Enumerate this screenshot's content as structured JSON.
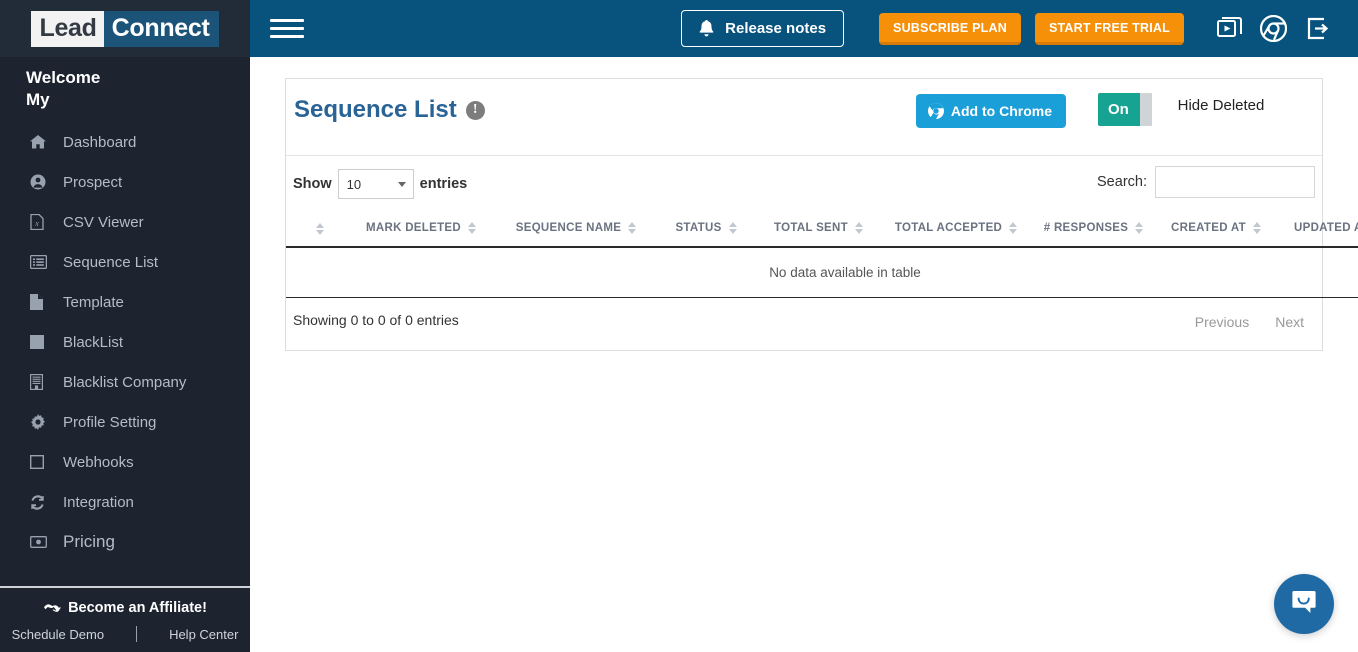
{
  "brand": {
    "logo_first": "Lead",
    "logo_second": "Connect",
    "accent_blue": "#1b5478",
    "header_blue": "#08537e",
    "sidebar_bg": "#1d2430",
    "orange": "#f79009",
    "chrome_blue": "#1a9fd9",
    "toggle_teal": "#17a391",
    "title_blue": "#2a6496",
    "intercom_blue": "#1f6aa5"
  },
  "sidebar": {
    "welcome_line1": "Welcome",
    "welcome_line2": "My",
    "items": [
      {
        "label": "Dashboard",
        "icon": "home-icon"
      },
      {
        "label": "Prospect",
        "icon": "user-circle-icon"
      },
      {
        "label": "CSV Viewer",
        "icon": "csv-file-icon"
      },
      {
        "label": "Sequence List",
        "icon": "list-table-icon"
      },
      {
        "label": "Template",
        "icon": "document-icon"
      },
      {
        "label": "BlackList",
        "icon": "square-icon"
      },
      {
        "label": "Blacklist Company",
        "icon": "building-icon"
      },
      {
        "label": "Profile Setting",
        "icon": "gear-icon"
      },
      {
        "label": "Webhooks",
        "icon": "empty-square-icon"
      },
      {
        "label": "Integration",
        "icon": "refresh-icon"
      },
      {
        "label": "Pricing",
        "icon": "money-icon"
      }
    ],
    "footer": {
      "affiliate": "Become an Affiliate!",
      "affiliate_icon": "handshake-icon",
      "schedule_demo": "Schedule Demo",
      "help_center": "Help Center"
    }
  },
  "topbar": {
    "menu_icon": "hamburger-icon",
    "release_notes": "Release notes",
    "release_notes_icon": "bell-icon",
    "subscribe_plan": "SUBSCRIBE PLAN",
    "start_free_trial": "START FREE TRIAL",
    "icons": [
      {
        "name": "video-tutorials-icon"
      },
      {
        "name": "chrome-extension-icon"
      },
      {
        "name": "logout-icon"
      }
    ]
  },
  "panel": {
    "title": "Sequence List",
    "info_icon": "exclamation-info-icon",
    "info_glyph": "!",
    "add_to_chrome": "Add to Chrome",
    "add_to_chrome_icon": "chrome-icon",
    "toggle": {
      "state_label": "On",
      "caption": "Hide Deleted"
    },
    "controls": {
      "show_label": "Show",
      "entries_label": "entries",
      "page_length": "10",
      "search_label": "Search:",
      "search_value": "",
      "search_placeholder": ""
    },
    "table": {
      "columns": [
        {
          "label": "",
          "sortable": true,
          "active": false
        },
        {
          "label": "MARK DELETED",
          "sortable": true,
          "active": false
        },
        {
          "label": "SEQUENCE NAME",
          "sortable": true,
          "active": false
        },
        {
          "label": "STATUS",
          "sortable": true,
          "active": false
        },
        {
          "label": "TOTAL SENT",
          "sortable": true,
          "active": false
        },
        {
          "label": "TOTAL ACCEPTED",
          "sortable": true,
          "active": false
        },
        {
          "label": "# RESPONSES",
          "sortable": true,
          "active": false
        },
        {
          "label": "CREATED AT",
          "sortable": true,
          "active": false
        },
        {
          "label": "UPDATED AT",
          "sortable": true,
          "active": true
        }
      ],
      "rows": [],
      "empty_message": "No data available in table"
    },
    "footer": {
      "info": "Showing 0 to 0 of 0 entries",
      "previous": "Previous",
      "next": "Next"
    }
  },
  "intercom": {
    "icon": "chat-bubble-smile-icon",
    "label": "Open Intercom Messenger"
  }
}
